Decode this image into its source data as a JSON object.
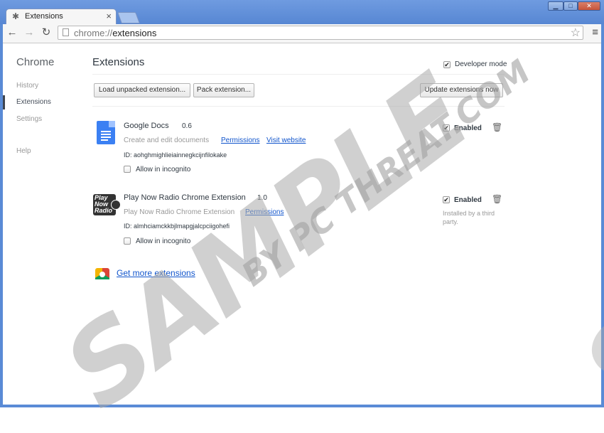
{
  "window": {
    "tab_title": "Extensions",
    "tab_icon": "puzzle-icon",
    "close_tab": "×",
    "minimize": "▁",
    "maximize": "□",
    "close": "✕"
  },
  "toolbar": {
    "url_scheme": "chrome://",
    "url_path": "extensions"
  },
  "sidebar": {
    "title": "Chrome",
    "items": [
      {
        "label": "History"
      },
      {
        "label": "Extensions"
      },
      {
        "label": "Settings"
      },
      {
        "label": "Help"
      }
    ]
  },
  "main": {
    "title": "Extensions",
    "developer_mode_label": "Developer mode",
    "developer_mode_checked": true,
    "buttons": {
      "load_unpacked": "Load unpacked extension...",
      "pack": "Pack extension...",
      "update": "Update extensions now"
    },
    "extensions": [
      {
        "name": "Google Docs",
        "version": "0.6",
        "description": "Create and edit documents",
        "permissions_label": "Permissions",
        "visit_label": "Visit website",
        "id": "ID: aohghmighlieiainnegkcijnfilokake",
        "incognito_label": "Allow in incognito",
        "enabled_label": "Enabled"
      },
      {
        "name": "Play Now Radio Chrome Extension",
        "version": "1.0",
        "description": "Play Now Radio Chrome Extension",
        "permissions_label": "Permissions",
        "id": "ID: almhciamckkbjlmapgjalcpciigohefi",
        "incognito_label": "Allow in incognito",
        "enabled_label": "Enabled",
        "installed_note": "Installed by a third party.",
        "logo_text": [
          "Play",
          "Now",
          "Radio"
        ]
      }
    ],
    "get_more": "Get more extensions"
  },
  "watermark": {
    "line1": "SAMPLE",
    "line2": "BY PC THREAT.COM",
    "line3": "S"
  }
}
